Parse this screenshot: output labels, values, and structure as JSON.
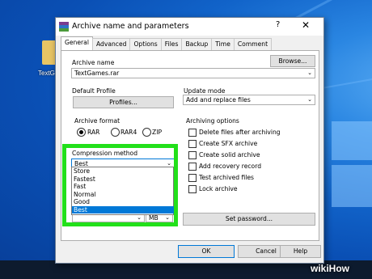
{
  "desktop": {
    "icon_label": "TextG"
  },
  "dialog": {
    "title": "Archive name and parameters",
    "help_label": "?",
    "close_label": "✕",
    "tabs": [
      "General",
      "Advanced",
      "Options",
      "Files",
      "Backup",
      "Time",
      "Comment"
    ],
    "archive_name_label": "Archive name",
    "archive_name_value": "TextGames.rar",
    "browse_label": "Browse...",
    "default_profile_label": "Default Profile",
    "profiles_label": "Profiles...",
    "update_mode_label": "Update mode",
    "update_mode_value": "Add and replace files",
    "archive_format_label": "Archive format",
    "formats": [
      "RAR",
      "RAR4",
      "ZIP"
    ],
    "selected_format": "RAR",
    "archiving_options_label": "Archiving options",
    "options": [
      "Delete files after archiving",
      "Create SFX archive",
      "Create solid archive",
      "Add recovery record",
      "Test archived files",
      "Lock archive"
    ],
    "compression_label": "Compression method",
    "compression_value": "Best",
    "compression_options": [
      "Store",
      "Fastest",
      "Fast",
      "Normal",
      "Good",
      "Best"
    ],
    "compression_selected": "Best",
    "split_unit": "MB",
    "set_password_label": "Set password...",
    "ok_label": "OK",
    "cancel_label": "Cancel",
    "help_button_label": "Help"
  },
  "watermark": "wikiHow",
  "colors": {
    "highlight": "#22e01a",
    "selection": "#0078d7"
  }
}
